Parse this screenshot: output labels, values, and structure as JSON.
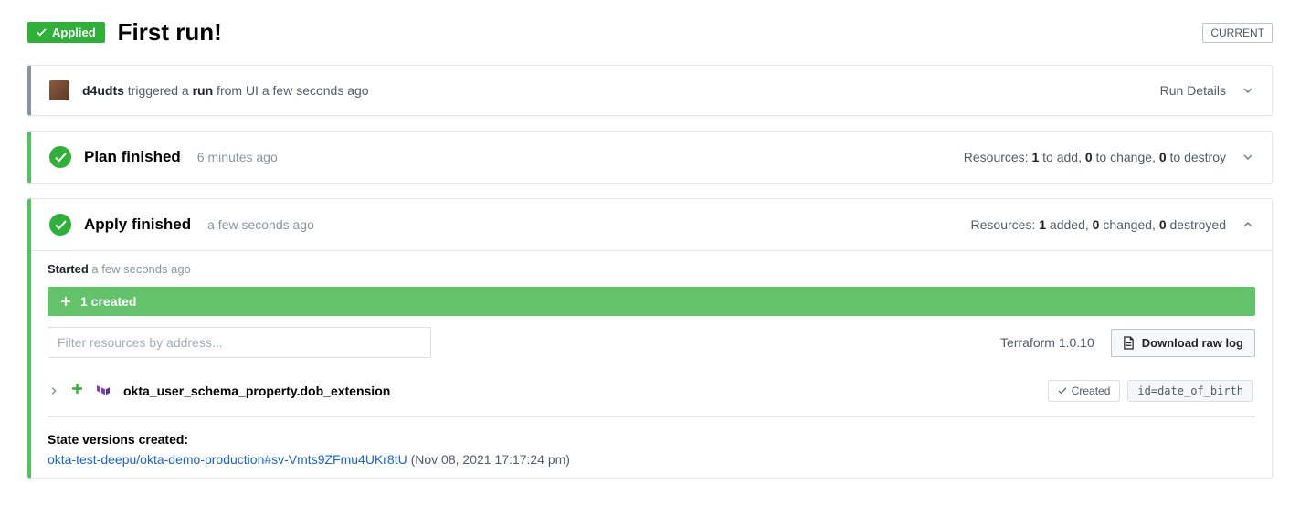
{
  "header": {
    "status_badge": "Applied",
    "title": "First run!",
    "current_badge": "CURRENT"
  },
  "trigger": {
    "user": "d4udts",
    "text_pre": " triggered a ",
    "action": "run",
    "text_post": " from UI a few seconds ago",
    "details_label": "Run Details"
  },
  "plan": {
    "title": "Plan finished",
    "time": "6 minutes ago",
    "res_prefix": "Resources: ",
    "add_n": "1",
    "add_t": " to add, ",
    "chg_n": "0",
    "chg_t": " to change, ",
    "del_n": "0",
    "del_t": " to destroy"
  },
  "apply": {
    "title": "Apply finished",
    "time": "a few seconds ago",
    "res_prefix": "Resources: ",
    "add_n": "1",
    "add_t": " added, ",
    "chg_n": "0",
    "chg_t": " changed, ",
    "del_n": "0",
    "del_t": " destroyed",
    "started_label": "Started",
    "started_time": " a few seconds ago",
    "created_bar": "1 created",
    "filter_placeholder": "Filter resources by address...",
    "tf_version": "Terraform 1.0.10",
    "download_label": "Download raw log",
    "resource": {
      "name": "okta_user_schema_property.dob_extension",
      "status": "Created",
      "id": "id=date_of_birth"
    },
    "state_label": "State versions created:",
    "state_link": "okta-test-deepu/okta-demo-production#sv-Vmts9ZFmu4UKr8tU",
    "state_date": " (Nov 08, 2021 17:17:24 pm)"
  }
}
